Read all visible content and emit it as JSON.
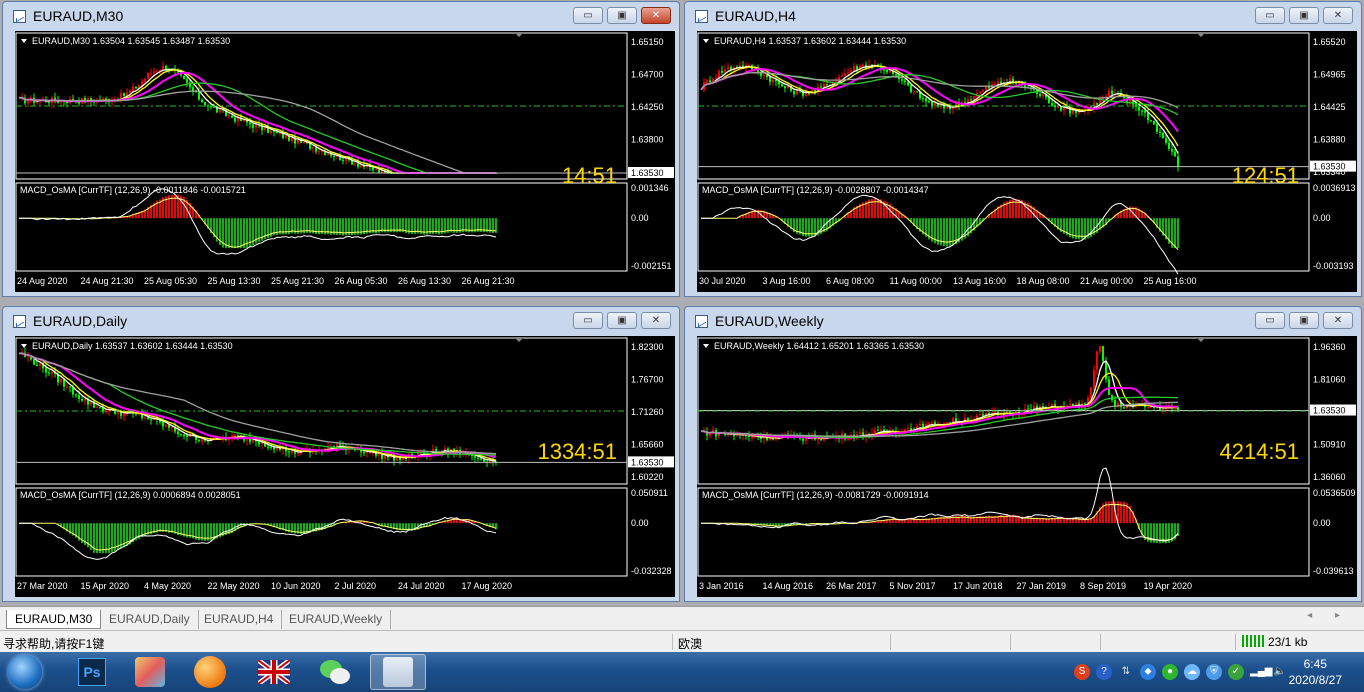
{
  "windows": [
    {
      "title": "EURAUD,M30",
      "info": "EURAUD,M30  1.63504 1.63545 1.63487 1.63530",
      "price_axis": [
        "1.65150",
        "1.64700",
        "1.64250",
        "1.63800",
        "1.63340"
      ],
      "current_price": "1.63530",
      "timer": "14:51",
      "osma_label": "MACD_OsMA [CurrTF] (12,26,9) -0.0011846 -0.0015721",
      "osma_axis": [
        "0.001346",
        "0.00",
        "-0.002151"
      ],
      "time_axis": [
        "24 Aug 2020",
        "24 Aug 21:30",
        "25 Aug 05:30",
        "25 Aug 13:30",
        "25 Aug 21:30",
        "26 Aug 05:30",
        "26 Aug 13:30",
        "26 Aug 21:30"
      ],
      "close_active": true
    },
    {
      "title": "EURAUD,H4",
      "info": "EURAUD,H4  1.63537 1.63602 1.63444 1.63530",
      "price_axis": [
        "1.65520",
        "1.64965",
        "1.64425",
        "1.63880",
        "1.63340"
      ],
      "current_price": "1.63530",
      "timer": "124:51",
      "osma_label": "MACD_OsMA [CurrTF] (12,26,9) -0.0028807 -0.0014347",
      "osma_axis": [
        "0.0036913",
        "0.00",
        "-0.003193"
      ],
      "time_axis": [
        "30 Jul 2020",
        "3 Aug 16:00",
        "6 Aug 08:00",
        "11 Aug 00:00",
        "13 Aug 16:00",
        "18 Aug 08:00",
        "21 Aug 00:00",
        "25 Aug 16:00"
      ],
      "close_active": false
    },
    {
      "title": "EURAUD,Daily",
      "info": "EURAUD,Daily  1.63537 1.63602 1.63444 1.63530",
      "price_axis": [
        "1.82300",
        "1.76700",
        "1.71260",
        "1.65660",
        "1.60220"
      ],
      "current_price": "1.63530",
      "timer": "1334:51",
      "osma_label": "MACD_OsMA [CurrTF] (12,26,9) 0.0006894 0.0028051",
      "osma_axis": [
        "0.050911",
        "0.00",
        "-0.032328"
      ],
      "time_axis": [
        "27 Mar 2020",
        "15 Apr 2020",
        "4 May 2020",
        "22 May 2020",
        "10 Jun 2020",
        "2 Jul 2020",
        "24 Jul 2020",
        "17 Aug 2020"
      ],
      "close_active": false
    },
    {
      "title": "EURAUD,Weekly",
      "info": "EURAUD,Weekly  1.64412 1.65201 1.63365 1.63530",
      "price_axis": [
        "1.96360",
        "1.81060",
        "1.65810",
        "1.50910",
        "1.36060"
      ],
      "current_price": "1.63530",
      "timer": "4214:51",
      "osma_label": "MACD_OsMA [CurrTF] (12,26,9) -0.0081729 -0.0091914",
      "osma_axis": [
        "0.0536509",
        "0.00",
        "-0.039613"
      ],
      "time_axis": [
        "3 Jan 2016",
        "14 Aug 2016",
        "26 Mar 2017",
        "5 Nov 2017",
        "17 Jun 2018",
        "27 Jan 2019",
        "8 Sep 2019",
        "19 Apr 2020"
      ],
      "close_active": false
    }
  ],
  "window_buttons": {
    "minimize": "▭",
    "maximize": "▣",
    "close": "✕"
  },
  "tabs": [
    "EURAUD,M30",
    "EURAUD,Daily",
    "EURAUD,H4",
    "EURAUD,Weekly"
  ],
  "tab_arrows": "◂ ▸",
  "status": {
    "help": "寻求帮助,请按F1键",
    "profile": "欧澳",
    "traffic": "23/1 kb"
  },
  "taskbar": {
    "apps": [
      "start-orb",
      "photoshop",
      "paint",
      "browser",
      "uk-flag-app",
      "wechat",
      "metatrader"
    ],
    "ps_label": "Ps",
    "time": "6:45",
    "date": "2020/8/27"
  },
  "colors": {
    "bull": "#ff0000",
    "bear": "#00ff00",
    "ma_magenta": "#ff00ff",
    "ma_yellow": "#ffff00",
    "ma_white": "#ffffff",
    "ma_gray": "#a0a0a0",
    "timer": "#ffd700"
  }
}
